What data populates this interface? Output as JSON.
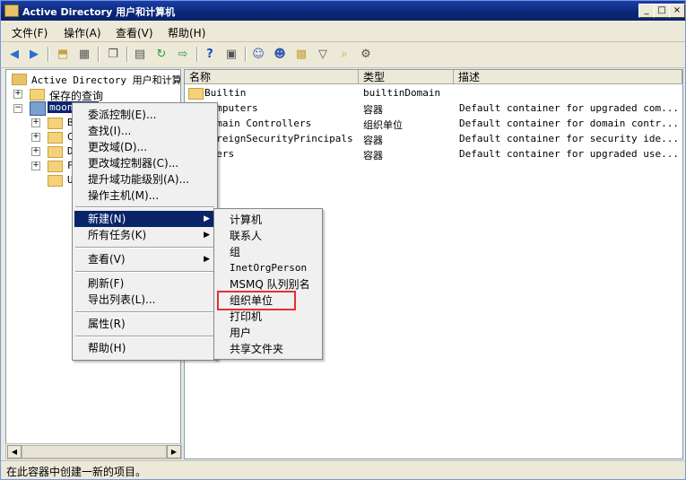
{
  "window": {
    "title": "Active Directory 用户和计算机",
    "controls": {
      "minimize": "_",
      "maximize": "□",
      "close": "×"
    }
  },
  "menubar": [
    {
      "label": "文件(F)"
    },
    {
      "label": "操作(A)"
    },
    {
      "label": "查看(V)"
    },
    {
      "label": "帮助(H)"
    }
  ],
  "toolbar_icons": [
    "back-icon",
    "forward-icon",
    "up-folder-icon",
    "show-hide-tree-icon",
    "copy-icon",
    "properties-icon",
    "refresh-icon",
    "export-list-icon",
    "help-icon",
    "console-icon",
    "new-user-icon",
    "new-group-icon",
    "new-ou-icon",
    "filter-icon",
    "find-icon",
    "delegate-icon"
  ],
  "tree": {
    "root": "Active Directory 用户和计算机",
    "saved_queries": "保存的查询",
    "domain": "moonx",
    "children": [
      "Bu",
      "Co",
      "Do",
      "Fo",
      "Us"
    ],
    "expanders": {
      "plus": "+",
      "minus": "−"
    }
  },
  "list": {
    "columns": [
      "名称",
      "类型",
      "描述"
    ],
    "rows": [
      {
        "name": "Builtin",
        "type": "builtinDomain",
        "desc": ""
      },
      {
        "name": "Computers",
        "type": "容器",
        "desc": "Default container for upgraded com..."
      },
      {
        "name": "Domain Controllers",
        "type": "组织单位",
        "desc": "Default container for domain contr..."
      },
      {
        "name": "ForeignSecurityPrincipals",
        "type": "容器",
        "desc": "Default container for security ide..."
      },
      {
        "name": "Users",
        "type": "容器",
        "desc": "Default container for upgraded use..."
      }
    ]
  },
  "context_menu": {
    "items": [
      {
        "label": "委派控制(E)..."
      },
      {
        "label": "查找(I)..."
      },
      {
        "label": "更改域(D)..."
      },
      {
        "label": "更改域控制器(C)..."
      },
      {
        "label": "提升域功能级别(A)..."
      },
      {
        "label": "操作主机(M)..."
      },
      {
        "label": "新建(N)",
        "arrow": "▶"
      },
      {
        "label": "所有任务(K)",
        "arrow": "▶"
      },
      {
        "label": "查看(V)",
        "arrow": "▶"
      },
      {
        "label": "刷新(F)"
      },
      {
        "label": "导出列表(L)..."
      },
      {
        "label": "属性(R)"
      },
      {
        "label": "帮助(H)"
      }
    ]
  },
  "submenu": {
    "items": [
      "计算机",
      "联系人",
      "组",
      "InetOrgPerson",
      "MSMQ 队列别名",
      "组织单位",
      "打印机",
      "用户",
      "共享文件夹"
    ],
    "highlighted": "组织单位"
  },
  "status": "在此容器中创建一新的项目。",
  "scroll": {
    "left": "◀",
    "right": "▶"
  }
}
